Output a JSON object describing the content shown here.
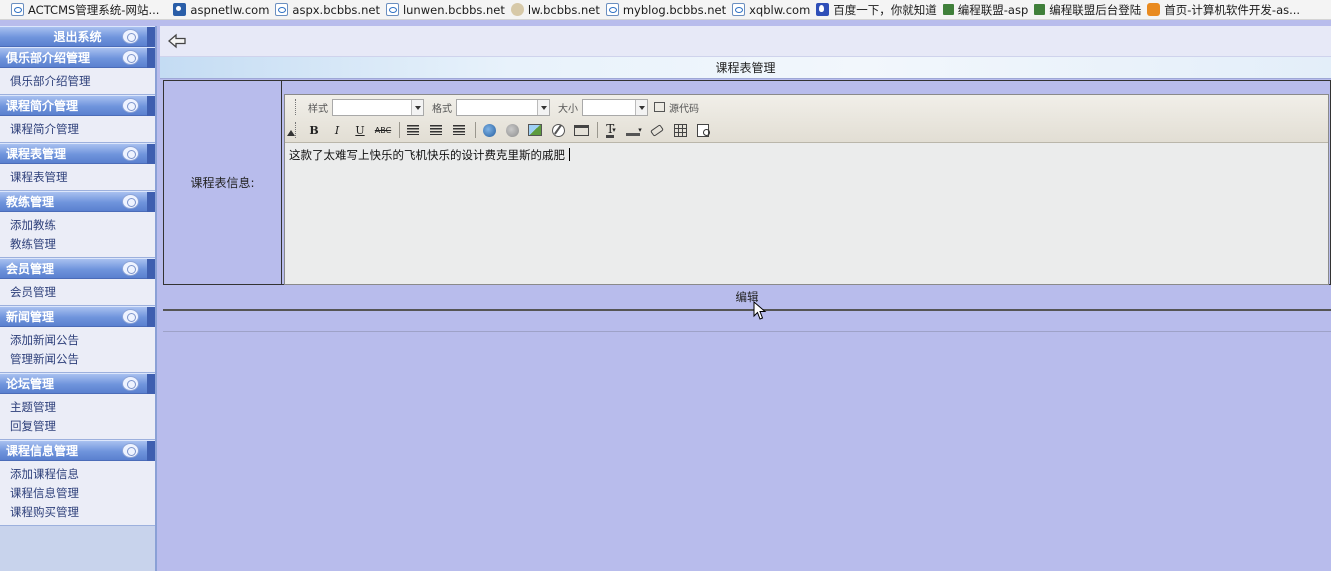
{
  "favorites": [
    {
      "label": "ACTCMS管理系统-网站...",
      "icon": "ie-page-icon"
    },
    {
      "label": "aspnetlw.com",
      "icon": "aspnet-icon"
    },
    {
      "label": "aspx.bcbbs.net",
      "icon": "ie-page-icon"
    },
    {
      "label": "lunwen.bcbbs.net",
      "icon": "ie-page-icon"
    },
    {
      "label": "lw.bcbbs.net",
      "icon": "swirl-icon"
    },
    {
      "label": "myblog.bcbbs.net",
      "icon": "ie-page-icon"
    },
    {
      "label": "xqblw.com",
      "icon": "ie-page-icon"
    },
    {
      "label": "百度一下，你就知道",
      "icon": "baidu-icon"
    },
    {
      "label": "编程联盟-asp",
      "icon": "site-icon"
    },
    {
      "label": "编程联盟后台登陆",
      "icon": "site-icon"
    },
    {
      "label": "首页-计算机软件开发-as...",
      "icon": "orange-site-icon"
    }
  ],
  "sidebar": {
    "logout": "退出系统",
    "sections": [
      {
        "title": "俱乐部介绍管理",
        "items": [
          "俱乐部介绍管理"
        ]
      },
      {
        "title": "课程简介管理",
        "items": [
          "课程简介管理"
        ]
      },
      {
        "title": "课程表管理",
        "items": [
          "课程表管理"
        ]
      },
      {
        "title": "教练管理",
        "items": [
          "添加教练",
          "教练管理"
        ]
      },
      {
        "title": "会员管理",
        "items": [
          "会员管理"
        ]
      },
      {
        "title": "新闻管理",
        "items": [
          "添加新闻公告",
          "管理新闻公告"
        ]
      },
      {
        "title": "论坛管理",
        "items": [
          "主题管理",
          "回复管理"
        ]
      },
      {
        "title": "课程信息管理",
        "items": [
          "添加课程信息",
          "课程信息管理",
          "课程购买管理"
        ]
      }
    ]
  },
  "main": {
    "title": "课程表管理",
    "field_label": "课程表信息:",
    "editor": {
      "style_label": "样式",
      "format_label": "格式",
      "size_label": "大小",
      "source_label": "源代码",
      "style_value": "",
      "format_value": "",
      "size_value": "",
      "bold": "B",
      "italic": "I",
      "underline": "U",
      "strike": "ABC",
      "text_color_glyph": "T",
      "content": "这款了太难写上快乐的飞机快乐的设计费克里斯的戚肥"
    },
    "submit_label": "编辑"
  },
  "colors": {
    "page_bg": "#b8bcec",
    "sidebar_header": "#6f94dc",
    "sidebar_bg": "#ebedf7",
    "title_bar": "#e8f2fb"
  }
}
